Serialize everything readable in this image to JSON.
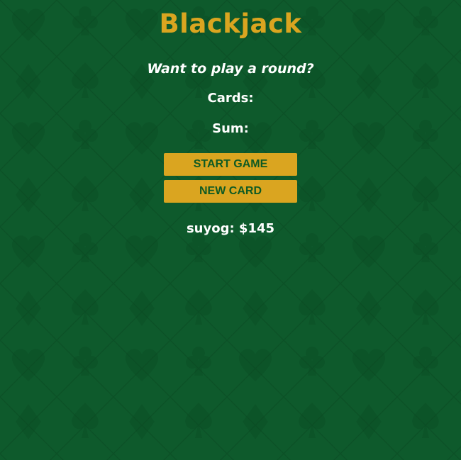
{
  "title": "Blackjack",
  "message": "Want to play a round?",
  "cards_label": "Cards:",
  "sum_label": "Sum:",
  "buttons": {
    "start": "START GAME",
    "new_card": "NEW CARD"
  },
  "player": {
    "text": "suyog: $145"
  },
  "colors": {
    "felt": "#0e5a2c",
    "accent": "#daa520",
    "button_text": "#0f5a23",
    "text": "#ffffff"
  },
  "background_icons": [
    "spade-icon",
    "heart-icon",
    "club-icon",
    "diamond-icon"
  ]
}
